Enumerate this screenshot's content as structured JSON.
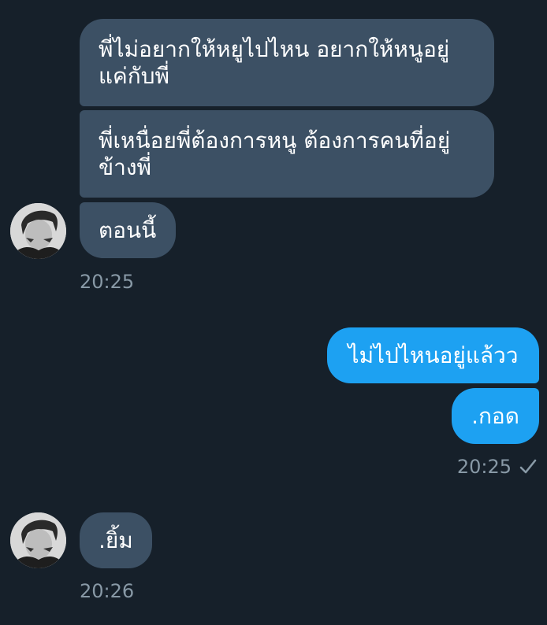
{
  "messages": [
    {
      "direction": "in",
      "text": "พี่ไม่อยากให้หยูไปไหน อยากให้หนูอยู่แค่กับพี่"
    },
    {
      "direction": "in",
      "text": "พี่เหนื่อยพี่ต้องการหนู ต้องการคนที่อยู่ข้างพี่"
    },
    {
      "direction": "in",
      "text": "ตอนนี้"
    },
    {
      "direction": "out",
      "text": "ไม่ไปไหนอยู่แล้วว"
    },
    {
      "direction": "out",
      "text": ".กอด"
    },
    {
      "direction": "in",
      "text": ".ยิ้ม"
    }
  ],
  "timestamps": {
    "group1": "20:25",
    "group2": "20:25",
    "group3": "20:26"
  },
  "icons": {
    "read_receipt": "checkmark-icon",
    "avatar": "contact-avatar"
  },
  "colors": {
    "background": "#16202a",
    "incoming_bubble": "#3c5064",
    "outgoing_bubble": "#1da1f2",
    "timestamp": "#8899a6"
  }
}
